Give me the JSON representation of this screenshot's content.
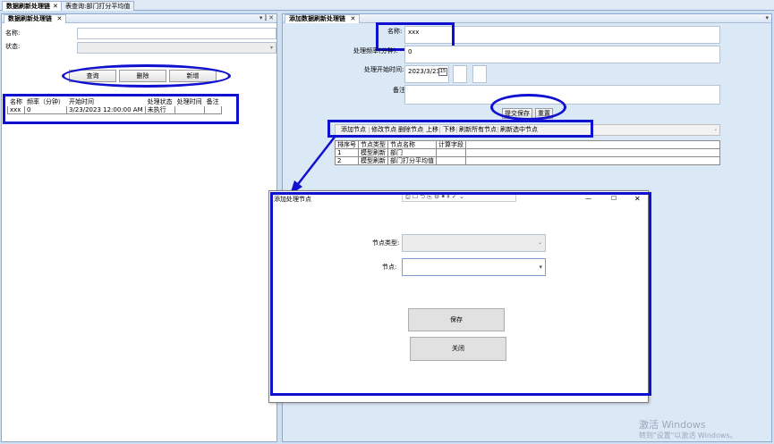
{
  "doc_tabs": [
    {
      "label": "数据刷新处理链",
      "close": "✕"
    },
    {
      "label": "表查询:部门打分平均值",
      "close": ""
    }
  ],
  "left_panel": {
    "tab_label": "数据刷新处理链",
    "tab_close": "✕",
    "panel_tools": "▾ ⫿ ✕",
    "name_label": "名称:",
    "name_value": "",
    "status_label": "状态:",
    "status_value": "",
    "buttons": {
      "query": "查询",
      "delete": "删除",
      "add": "新增"
    },
    "table": {
      "headers": [
        "名称",
        "频率（分钟）",
        "开始时间",
        "处理状态",
        "处理时间",
        "备注"
      ],
      "rows": [
        [
          "xxx",
          "0",
          "3/23/2023 12:00:00 AM",
          "未执行",
          "",
          ""
        ]
      ]
    }
  },
  "right_panel": {
    "tab_label": "添加数据刷新处理链",
    "tab_close": "✕",
    "panel_tools": "▾",
    "name_label": "名称:",
    "name_value": "xxx",
    "freq_label": "处理频率(分钟):",
    "freq_value": "0",
    "start_label": "处理开始时间:",
    "start_value": "2023/3/23",
    "calendar_label": "15",
    "note_label": "备注:",
    "note_value": "",
    "submit_label": "提交保存",
    "reset_label": "重置",
    "node_toolbar": [
      "添加节点",
      "修改节点",
      "删除节点",
      "上移",
      "下移",
      "刷新所有节点",
      "刷新选中节点"
    ],
    "node_table": {
      "headers": [
        "排序号",
        "节点类型",
        "节点名称",
        "计算字段"
      ],
      "rows": [
        [
          "1",
          "模型刷新",
          "部门",
          ""
        ],
        [
          "2",
          "模型刷新",
          "部门打分平均值",
          ""
        ]
      ]
    }
  },
  "dialog": {
    "title": "添加处理节点",
    "node_type_label": "节点类型:",
    "node_type_value": "",
    "node_label": "节点:",
    "node_value": "",
    "save_label": "保存",
    "close_label": "关闭",
    "win_minimize": "—",
    "win_maximize": "☐",
    "win_close": "✕",
    "floating_toolbar_glyphs": "⎙ ☐ ⮌ ⎘ ⚙ ⏺ ⏸ ✓ ⌄"
  },
  "watermark": {
    "line1": "激活 Windows",
    "line2": "转到\"设置\"以激活 Windows。"
  },
  "colors": {
    "annotation_blue": "#1010d0",
    "background": "#cfe0f3"
  }
}
